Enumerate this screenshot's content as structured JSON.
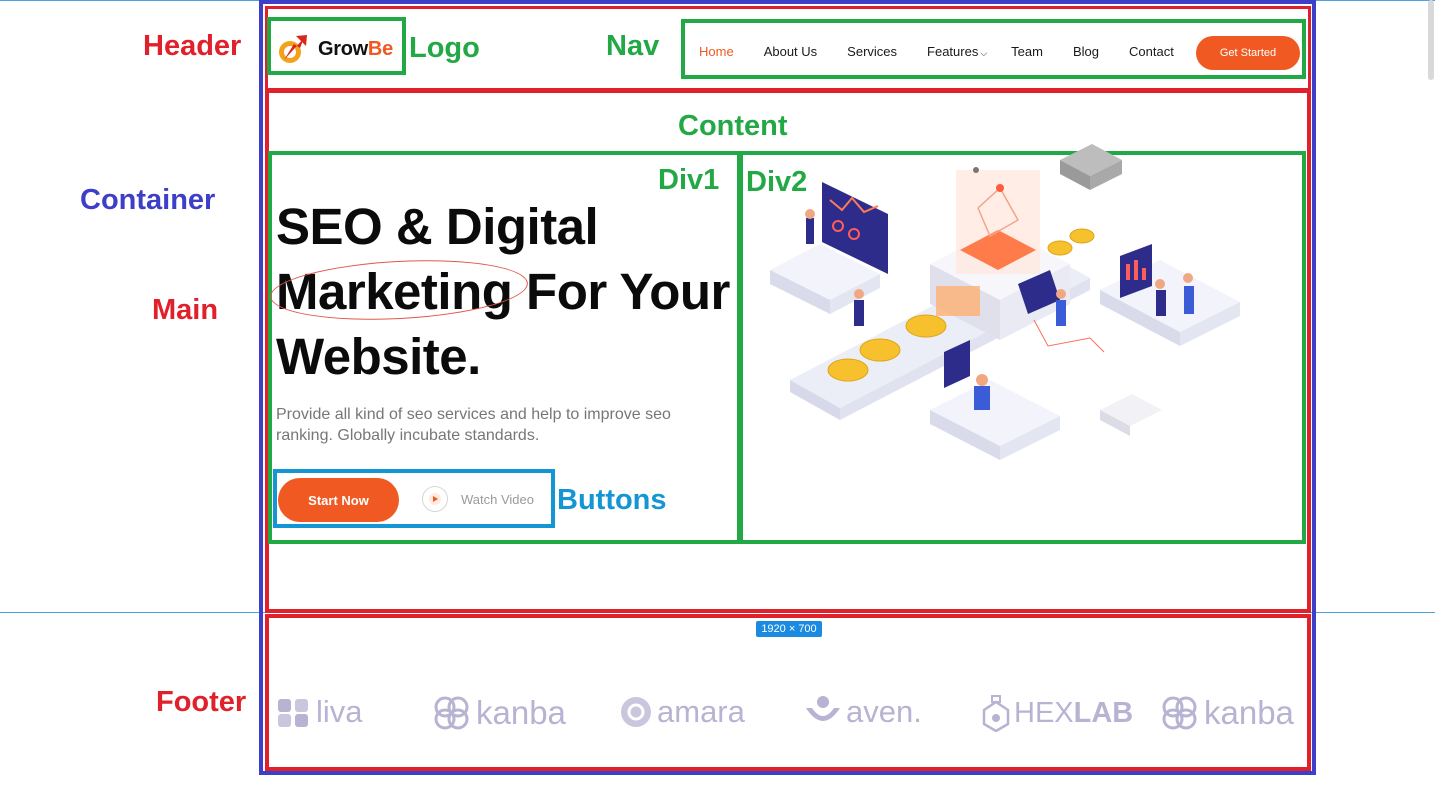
{
  "annotations": {
    "header": "Header",
    "logo": "Logo",
    "nav": "Nav",
    "content": "Content",
    "container": "Container",
    "main": "Main",
    "div1": "Div1",
    "div2": "Div2",
    "buttons": "Buttons",
    "footer": "Footer"
  },
  "colors": {
    "red_box": "#e0202a",
    "green_box": "#22a845",
    "blue_box": "#3d3fc8",
    "cyan_box": "#1596d4",
    "accent": "#f05a22"
  },
  "header": {
    "logo": {
      "text_main": "Grow",
      "text_accent": "Be",
      "icon": "rocket-arrow-icon"
    },
    "nav": [
      {
        "label": "Home",
        "active": true
      },
      {
        "label": "About Us"
      },
      {
        "label": "Services"
      },
      {
        "label": "Features",
        "has_dropdown": true
      },
      {
        "label": "Team"
      },
      {
        "label": "Blog"
      },
      {
        "label": "Contact"
      }
    ],
    "cta_label": "Get Started"
  },
  "hero": {
    "title_line1": "SEO & Digital",
    "title_word_circled": "Marketing",
    "title_line2_rest": " For Your",
    "title_line3": "Website.",
    "subtitle": "Provide all kind of seo services and help to improve seo ranking. Globally incubate standards.",
    "start_label": "Start Now",
    "watch_label": "Watch Video",
    "illustration": "isometric-seo-illustration"
  },
  "size_badge": "1920 × 700",
  "brands": [
    {
      "name": "liva",
      "icon": "liva-logo-icon"
    },
    {
      "name": "kanba",
      "icon": "kanba-logo-icon"
    },
    {
      "name": "amara",
      "icon": "amara-logo-icon"
    },
    {
      "name": "aven.",
      "icon": "aven-logo-icon"
    },
    {
      "name_light": "HEX",
      "name_bold": "LAB",
      "icon": "hexlab-logo-icon"
    },
    {
      "name": "kanba",
      "icon": "kanba-logo-icon"
    }
  ]
}
